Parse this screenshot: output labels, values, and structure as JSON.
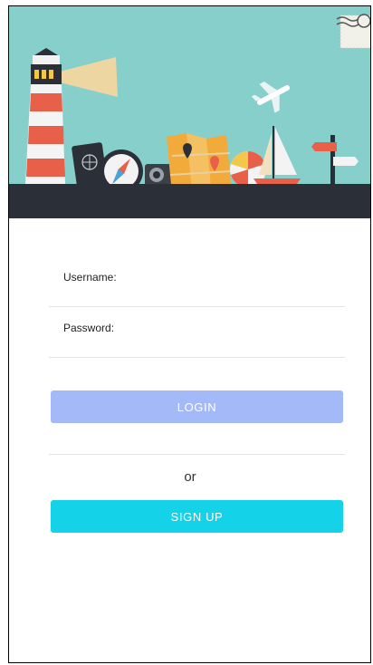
{
  "login_form": {
    "username_label": "Username:",
    "username_value": "",
    "password_label": "Password:",
    "password_value": "",
    "login_label": "LOGIN",
    "or_text": "or",
    "signup_label": "SIGN UP"
  },
  "hero": {
    "icons": [
      "lighthouse-icon",
      "passport-icon",
      "compass-icon",
      "camera-icon",
      "map-icon",
      "beach-ball-icon",
      "sailboat-icon",
      "airplane-icon",
      "signpost-icon",
      "stamp-icon"
    ]
  },
  "colors": {
    "sky": "#87cfcb",
    "ground": "#2b2f38",
    "login_button": "#a4baf8",
    "signup_button": "#14d2e8"
  }
}
